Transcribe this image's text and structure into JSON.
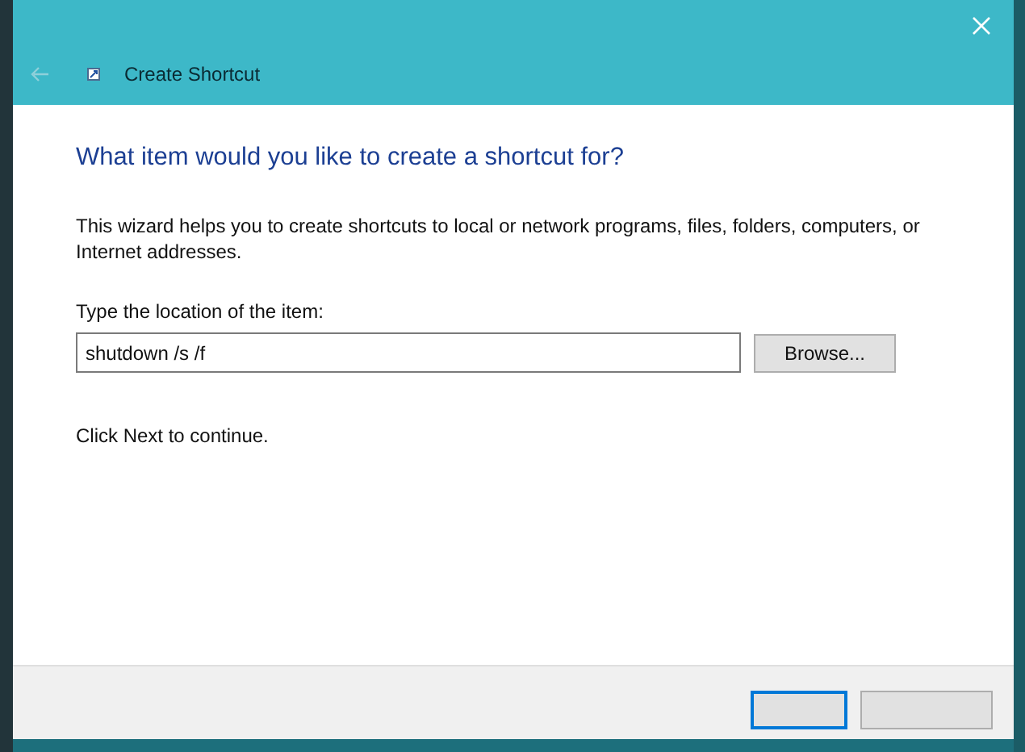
{
  "window": {
    "title": "Create Shortcut"
  },
  "heading": "What item would you like to create a shortcut for?",
  "description": "This wizard helps you to create shortcuts to local or network programs, files, folders, computers, or Internet addresses.",
  "location": {
    "label": "Type the location of the item:",
    "value": "shutdown /s /f",
    "browse": "Browse..."
  },
  "hint": "Click Next to continue.",
  "footer_buttons": [
    {
      "focused": true
    },
    {
      "focused": false
    }
  ]
}
